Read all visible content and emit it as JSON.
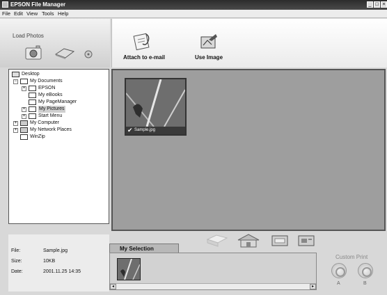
{
  "window": {
    "title": "EPSON File Manager",
    "controls": {
      "minimize": "_",
      "maximize": "□",
      "close": "×"
    }
  },
  "menu": {
    "items": [
      "File",
      "Edit",
      "View",
      "Tools",
      "Help"
    ]
  },
  "load_photos": {
    "label": "Load Photos",
    "icons": [
      "camera-icon",
      "scanner-icon",
      "disc-icon"
    ]
  },
  "toolbar": {
    "attach_email": {
      "label": "Attach to e-mail",
      "icon": "email-attach-icon"
    },
    "use_image": {
      "label": "Use Image",
      "icon": "use-image-icon"
    }
  },
  "tree": {
    "root": "Desktop",
    "my_documents": "My Documents",
    "epson": "EPSON",
    "my_ebooks": "My eBooks",
    "my_pagemanager": "My PageManager",
    "my_pictures": "My Pictures",
    "start_menu": "Start Menu",
    "my_computer": "My Computer",
    "my_network_places": "My Network Places",
    "winzip": "WinZip",
    "selected": "My Pictures"
  },
  "thumbnail": {
    "name": "Sample.jpg",
    "checked": true
  },
  "file_info": {
    "file_label": "File:",
    "file_value": "Sample.jpg",
    "size_label": "Size:",
    "size_value": "10KB",
    "date_label": "Date:",
    "date_value": "2001.11.25 14:35"
  },
  "selection": {
    "tab_label": "My Selection",
    "icons": [
      "print-icon",
      "house-icon",
      "slideshow-icon",
      "card-icon"
    ]
  },
  "custom_print": {
    "label": "Custom Print",
    "button_a": "A",
    "button_b": "B"
  },
  "colors": {
    "title_bar": "#3a3a3a",
    "content_bg": "#9e9e9e",
    "tree_bg": "#ffffff"
  }
}
